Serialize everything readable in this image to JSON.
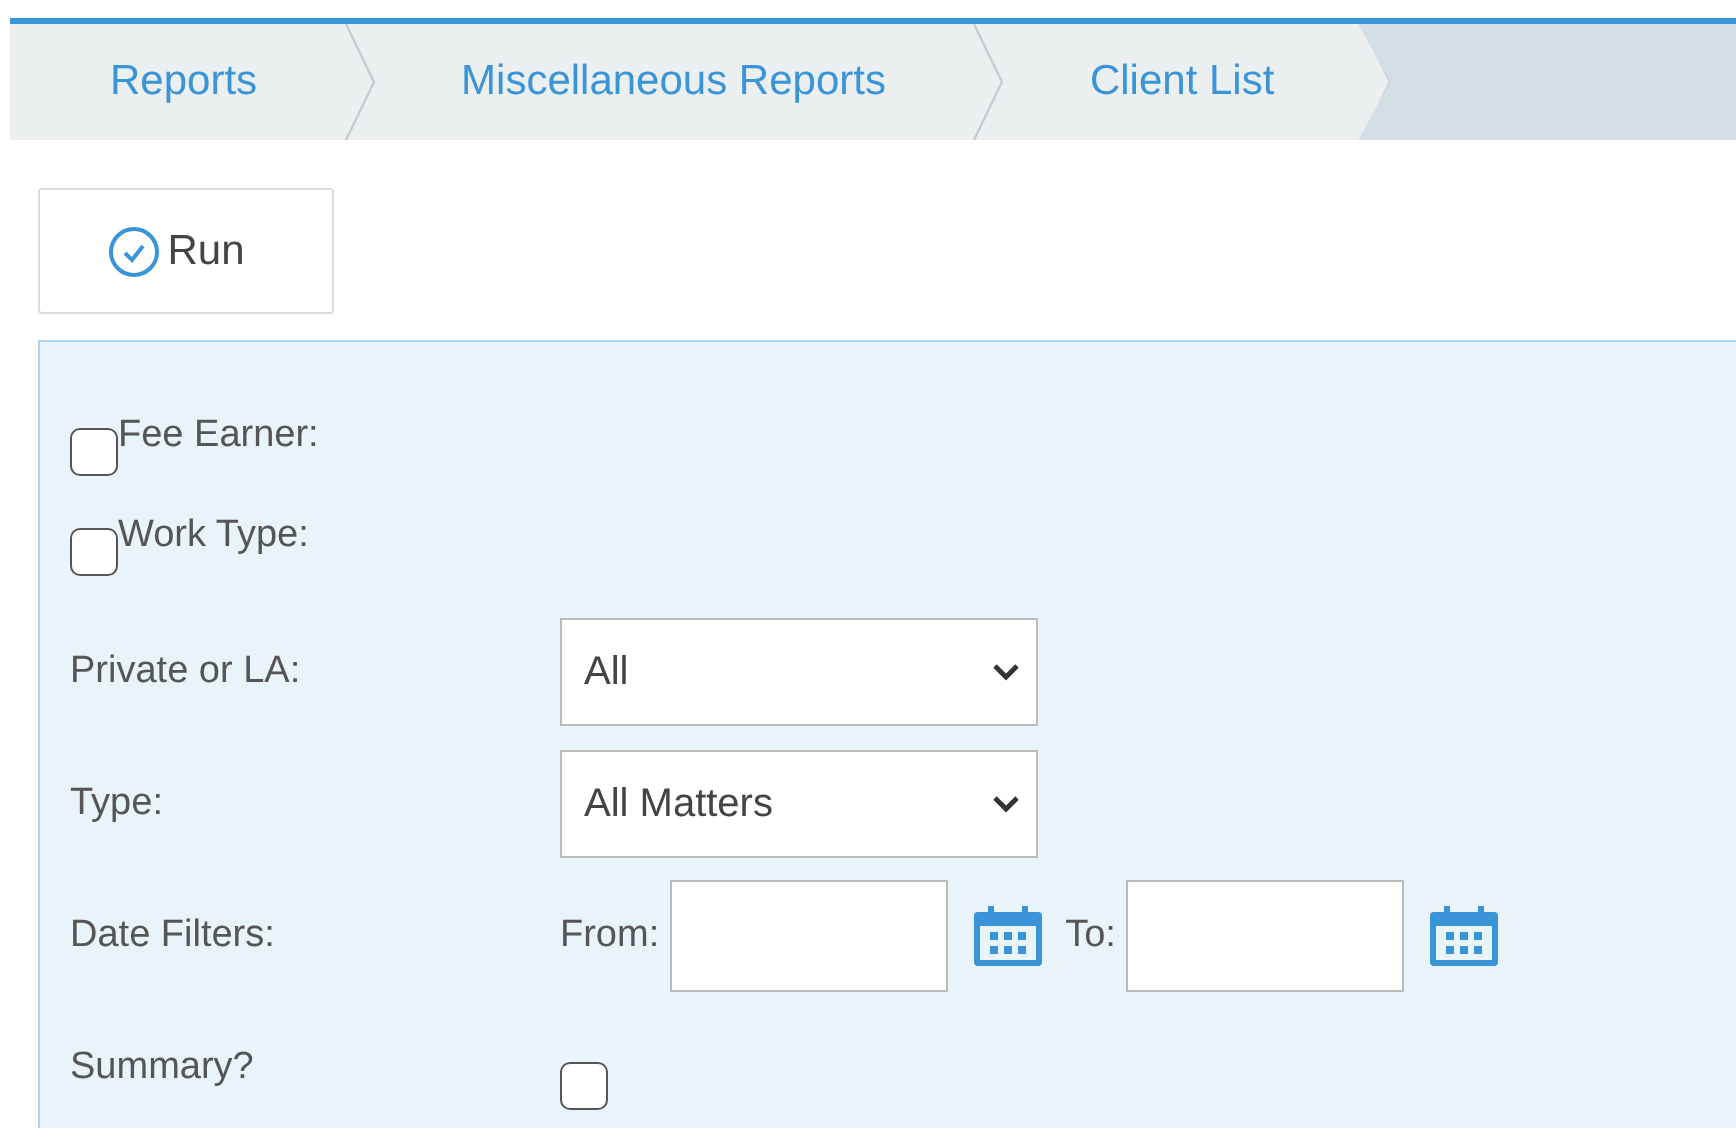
{
  "breadcrumbs": [
    {
      "label": "Reports"
    },
    {
      "label": "Miscellaneous Reports"
    },
    {
      "label": "Client List"
    }
  ],
  "run_button": {
    "label": "Run"
  },
  "filters": [
    {
      "kind": "check-label",
      "label": "Fee Earner:",
      "checked": false
    },
    {
      "kind": "check-label",
      "label": "Work Type:",
      "checked": false
    },
    {
      "kind": "select",
      "label": "Private or LA:",
      "value": "All"
    },
    {
      "kind": "select",
      "label": "Type:",
      "value": "All Matters"
    },
    {
      "kind": "date-range",
      "label": "Date Filters:",
      "from_label": "From:",
      "to_label": "To:"
    },
    {
      "kind": "checkbox",
      "label": "Summary?",
      "checked": false
    }
  ]
}
